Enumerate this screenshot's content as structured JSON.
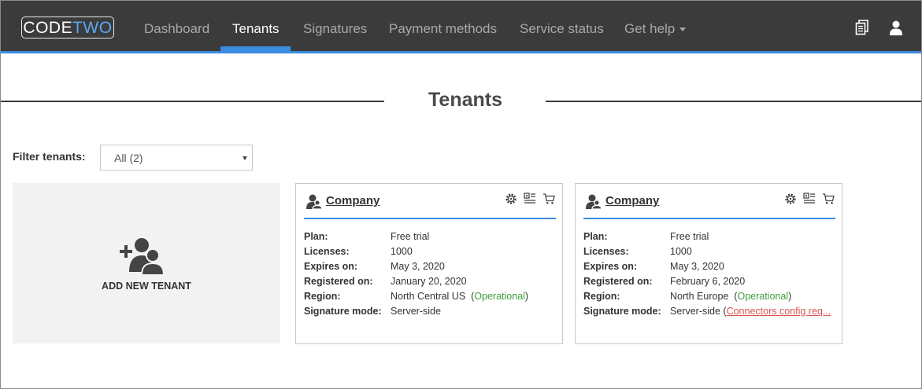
{
  "header": {
    "logo": {
      "part1": "CODE",
      "part2": "TWO"
    },
    "nav": [
      {
        "label": "Dashboard"
      },
      {
        "label": "Tenants"
      },
      {
        "label": "Signatures"
      },
      {
        "label": "Payment methods"
      },
      {
        "label": "Service status"
      },
      {
        "label": "Get help"
      }
    ],
    "active_nav": "Tenants"
  },
  "page": {
    "title": "Tenants"
  },
  "filter": {
    "label": "Filter tenants:",
    "selected": "All (2)"
  },
  "add_tile": {
    "label": "ADD NEW TENANT"
  },
  "tenants": [
    {
      "name": "Company",
      "plan_label": "Plan:",
      "plan": "Free trial",
      "licenses_label": "Licenses:",
      "licenses": "1000",
      "expires_label": "Expires on:",
      "expires": "May 3, 2020",
      "registered_label": "Registered on:",
      "registered": "January 20, 2020",
      "region_label": "Region:",
      "region": "North Central US",
      "region_status": "Operational",
      "mode_label": "Signature mode:",
      "mode": "Server-side",
      "mode_note": ""
    },
    {
      "name": "Company",
      "plan_label": "Plan:",
      "plan": "Free trial",
      "licenses_label": "Licenses:",
      "licenses": "1000",
      "expires_label": "Expires on:",
      "expires": "May 3, 2020",
      "registered_label": "Registered on:",
      "registered": "February 6, 2020",
      "region_label": "Region:",
      "region": "North Europe",
      "region_status": "Operational",
      "mode_label": "Signature mode:",
      "mode": "Server-side",
      "mode_note": "Connectors config req..."
    }
  ],
  "colors": {
    "navbar": "#3b3b3b",
    "accent": "#3a8de0",
    "operational": "#3d9e3d",
    "warning_link": "#d9534f"
  }
}
